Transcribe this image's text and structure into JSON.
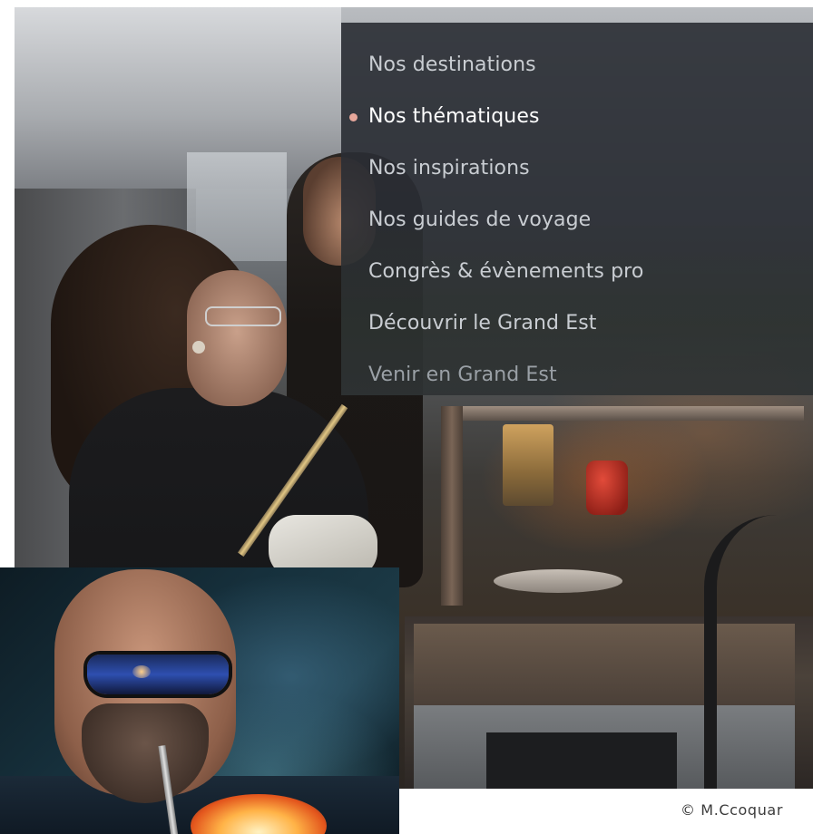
{
  "nav": {
    "items": [
      {
        "label": "Nos destinations",
        "state": "default"
      },
      {
        "label": "Nos thématiques",
        "state": "active"
      },
      {
        "label": "Nos inspirations",
        "state": "default"
      },
      {
        "label": "Nos guides de voyage",
        "state": "default"
      },
      {
        "label": "Congrès & évènements pro",
        "state": "default"
      },
      {
        "label": "Découvrir le Grand Est",
        "state": "default"
      },
      {
        "label": "Venir en Grand Est",
        "state": "faded"
      }
    ],
    "active_marker_color": "#e7a79b"
  },
  "photos": {
    "main": {
      "subject": "workers-in-glass-workshop"
    },
    "inset": {
      "subject": "glassblower-with-goggles"
    }
  },
  "credit": {
    "text": "© M.Ccoquar"
  },
  "colors": {
    "menu_background": "#2a2e34",
    "menu_text": "#c9cdd2",
    "menu_text_active": "#ffffff",
    "page_background": "#ffffff"
  }
}
